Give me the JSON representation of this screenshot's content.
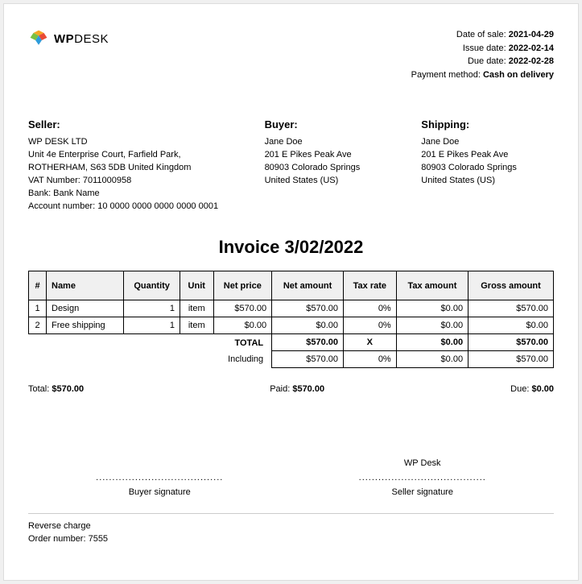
{
  "logo": {
    "brand_part1": "WP",
    "brand_part2": "DESK"
  },
  "meta": {
    "sale_label": "Date of sale:",
    "sale_value": "2021-04-29",
    "issue_label": "Issue date:",
    "issue_value": "2022-02-14",
    "due_label": "Due date:",
    "due_value": "2022-02-28",
    "payment_label": "Payment method:",
    "payment_value": "Cash on delivery"
  },
  "seller": {
    "heading": "Seller:",
    "lines": [
      "WP DESK LTD",
      "Unit 4e Enterprise Court, Farfield Park, ROTHERHAM, S63 5DB United Kingdom",
      "VAT Number: 7011000958",
      "Bank: Bank Name",
      "Account number: 10 0000 0000 0000 0000 0001"
    ]
  },
  "buyer": {
    "heading": "Buyer:",
    "lines": [
      "Jane Doe",
      "201 E Pikes Peak Ave",
      "80903 Colorado Springs",
      "United States (US)"
    ]
  },
  "shipping": {
    "heading": "Shipping:",
    "lines": [
      "Jane Doe",
      "201 E Pikes Peak Ave",
      "80903 Colorado Springs",
      "United States (US)"
    ]
  },
  "invoice_title": "Invoice 3/02/2022",
  "table": {
    "headers": {
      "idx": "#",
      "name": "Name",
      "qty": "Quantity",
      "unit": "Unit",
      "net_price": "Net price",
      "net_amount": "Net amount",
      "tax_rate": "Tax rate",
      "tax_amount": "Tax amount",
      "gross": "Gross amount"
    },
    "rows": [
      {
        "idx": "1",
        "name": "Design",
        "qty": "1",
        "unit": "item",
        "net_price": "$570.00",
        "net_amount": "$570.00",
        "tax_rate": "0%",
        "tax_amount": "$0.00",
        "gross": "$570.00"
      },
      {
        "idx": "2",
        "name": "Free shipping",
        "qty": "1",
        "unit": "item",
        "net_price": "$0.00",
        "net_amount": "$0.00",
        "tax_rate": "0%",
        "tax_amount": "$0.00",
        "gross": "$0.00"
      }
    ],
    "total": {
      "label": "TOTAL",
      "net_amount": "$570.00",
      "tax_rate": "X",
      "tax_amount": "$0.00",
      "gross": "$570.00"
    },
    "including": {
      "label": "Including",
      "net_amount": "$570.00",
      "tax_rate": "0%",
      "tax_amount": "$0.00",
      "gross": "$570.00"
    }
  },
  "summary": {
    "total_label": "Total:",
    "total_value": "$570.00",
    "paid_label": "Paid:",
    "paid_value": "$570.00",
    "due_label": "Due:",
    "due_value": "$0.00"
  },
  "signatures": {
    "dots": ".......................................",
    "buyer_signer": "",
    "buyer_label": "Buyer signature",
    "seller_signer": "WP Desk",
    "seller_label": "Seller signature"
  },
  "footer": {
    "line1": "Reverse charge",
    "line2": "Order number: 7555"
  }
}
